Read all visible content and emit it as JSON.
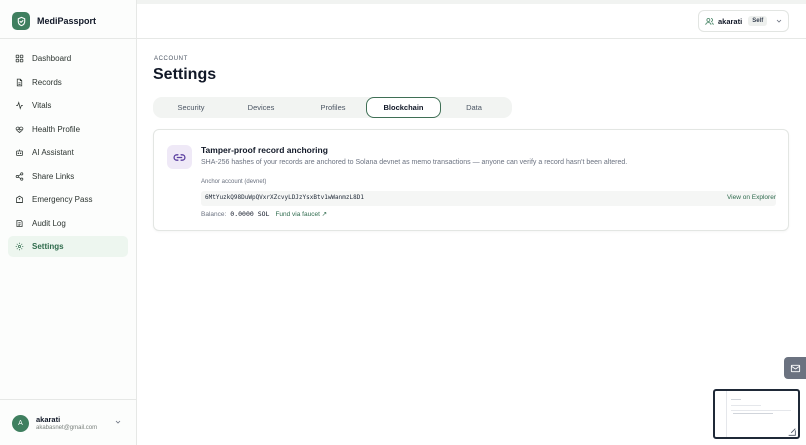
{
  "app": {
    "name": "MediPassport",
    "colors": {
      "brand": "#3f7f5f",
      "accent_link": "#2f6b4e",
      "active_bg": "#edf6ef"
    }
  },
  "sidebar": {
    "items": [
      {
        "label": "Dashboard",
        "icon": "grid-icon"
      },
      {
        "label": "Records",
        "icon": "file-icon"
      },
      {
        "label": "Vitals",
        "icon": "pulse-icon"
      },
      {
        "label": "Health Profile",
        "icon": "heart-icon"
      },
      {
        "label": "AI Assistant",
        "icon": "bot-icon"
      },
      {
        "label": "Share Links",
        "icon": "share-icon"
      },
      {
        "label": "Emergency Pass",
        "icon": "ambulance-icon"
      },
      {
        "label": "Audit Log",
        "icon": "log-icon"
      },
      {
        "label": "Settings",
        "icon": "gear-icon",
        "active": true
      }
    ],
    "user": {
      "initial": "A",
      "name": "akarati",
      "email": "akabasnet@gmail.com"
    }
  },
  "header": {
    "user_name": "akarati",
    "badge": "Self"
  },
  "page": {
    "eyebrow": "ACCOUNT",
    "title": "Settings",
    "tabs": [
      {
        "label": "Security"
      },
      {
        "label": "Devices"
      },
      {
        "label": "Profiles"
      },
      {
        "label": "Blockchain",
        "active": true
      },
      {
        "label": "Data"
      }
    ]
  },
  "blockchain": {
    "title": "Tamper-proof record anchoring",
    "description": "SHA-256 hashes of your records are anchored to Solana devnet as memo transactions — anyone can verify a record hasn't been altered.",
    "account_label": "Anchor account (devnet)",
    "account_address": "6MtYuzkQ98DuWpQVxrXZcvyLDJzYsxBtv1wWanmzL8D1",
    "explorer_link": "View on Explorer",
    "balance_label": "Balance:",
    "balance_value": "0.0000 SOL",
    "faucet_link": "Fund via faucet ↗"
  }
}
